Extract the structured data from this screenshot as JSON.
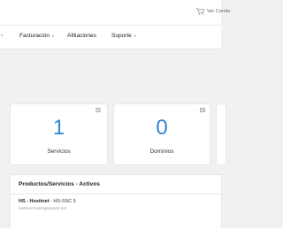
{
  "topbar": {
    "cart_label": "Ver Carrito",
    "cart_icon": "cart-icon"
  },
  "nav": {
    "items": [
      {
        "label": "Facturación",
        "has_dropdown": true
      },
      {
        "label": "Afiliaciones",
        "has_dropdown": false
      },
      {
        "label": "Soporte",
        "has_dropdown": true
      }
    ],
    "caret": "▾"
  },
  "stats": [
    {
      "value": "1",
      "label": "Servicios",
      "icon": "list-icon"
    },
    {
      "value": "0",
      "label": "Dominios",
      "icon": "globe-icon"
    }
  ],
  "products_panel": {
    "title": "Productos/Servicios - Activos",
    "rows": [
      {
        "group": "HS - Hostinet",
        "plan": " - HS-SSC 5",
        "domain": "hostinet.hostingesporte.net"
      }
    ]
  },
  "colors": {
    "accent": "#2f87d0",
    "background": "#f1f1f1"
  }
}
